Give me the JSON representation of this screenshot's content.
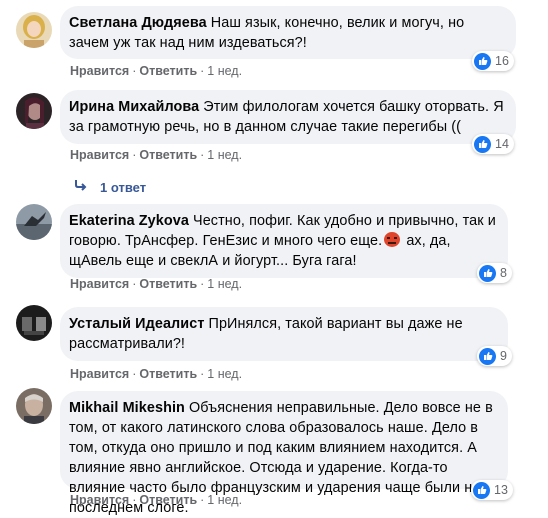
{
  "comments": [
    {
      "author": "Светлана Дюдяева",
      "text": "Наш язык, конечно, велик и могуч, но зачем уж так над ним издеваться?!",
      "like": "Нравится",
      "reply": "Ответить",
      "time": "1 нед.",
      "reactions": "16"
    },
    {
      "author": "Ирина Михайлова",
      "text": "Этим филологам хочется башку оторвать. Я за грамотную речь, но в данном случае такие перегибы ((",
      "like": "Нравится",
      "reply": "Ответить",
      "time": "1 нед.",
      "reactions": "14",
      "replies_label": "1 ответ"
    },
    {
      "author": "Ekaterina Zykova",
      "text_before": "Честно, пофиг. Как удобно и привычно, так и говорю. ТрАнсфер. ГенЕзис и много чего еще.",
      "text_after": " ах, да, щАвель еще и свеклА и йогурт... Буга гага!",
      "like": "Нравится",
      "reply": "Ответить",
      "time": "1 нед.",
      "reactions": "8"
    },
    {
      "author": "Усталый Идеалист",
      "text": "ПрИнялся, такой вариант вы даже не рассматривали?!",
      "like": "Нравится",
      "reply": "Ответить",
      "time": "1 нед.",
      "reactions": "9"
    },
    {
      "author": "Mikhail Mikeshin",
      "text": "Объяснения неправильные. Дело вовсе не в том, от какого латинского слова образовалось наше. Дело в том, откуда оно пришло и под каким влиянием находится. А влияние явно английское. Отсюда и ударение. Когда-то влияние часто было французским и ударения чаще были на последнем слоге.",
      "like": "Нравится",
      "reply": "Ответить",
      "time": "1 нед.",
      "reactions": "13"
    }
  ],
  "sep": "·",
  "colors": {
    "like_blue": "#1877f2",
    "bubble": "#f0f2f5",
    "meta": "#65676b",
    "link": "#385898"
  },
  "icons": [
    "thumbs-up-icon",
    "reply-arrow-icon",
    "angry-emoji-icon"
  ]
}
